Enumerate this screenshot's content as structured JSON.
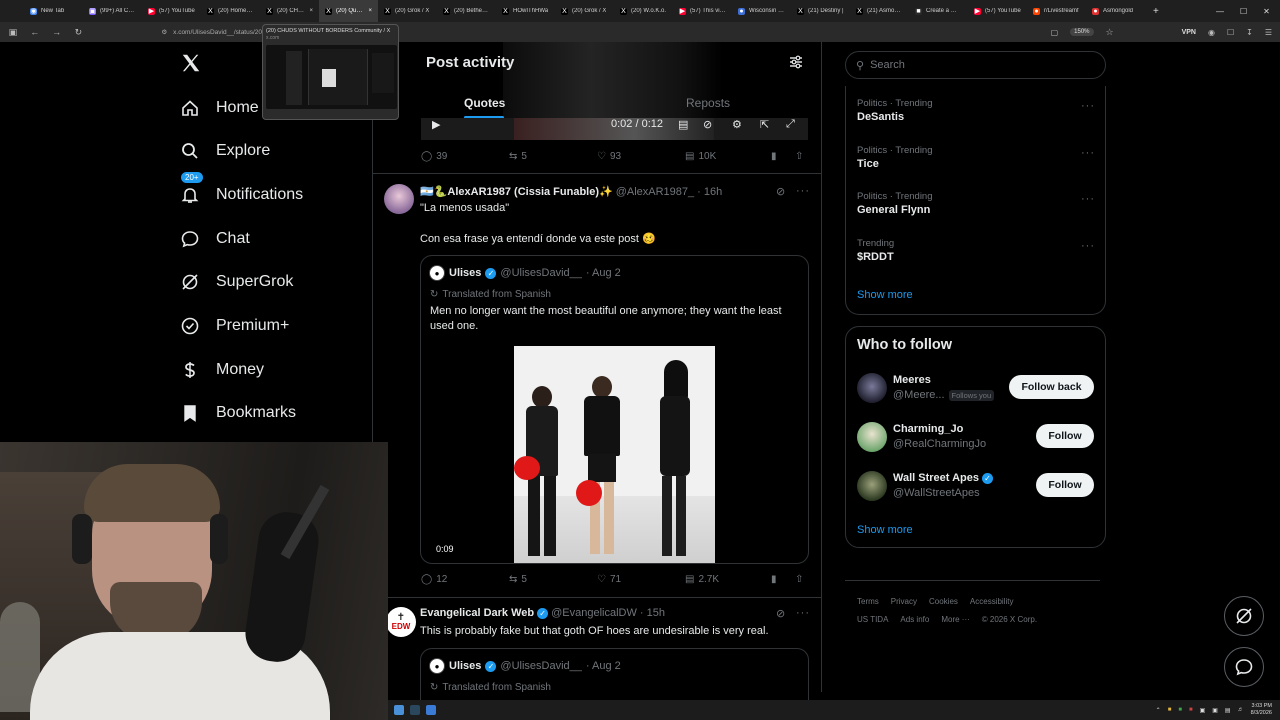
{
  "browser": {
    "tabs": [
      {
        "label": "New Tab",
        "color": "#4285f4",
        "glyph": "◉"
      },
      {
        "label": "(99+) All Cate",
        "color": "#7b5cff",
        "glyph": "▣"
      },
      {
        "label": "(57) YouTube",
        "color": "#ff0033",
        "glyph": "▶"
      },
      {
        "label": "(20) Home / X",
        "color": "#000000",
        "glyph": "X"
      },
      {
        "label": "(20) CHUDS W",
        "color": "#000000",
        "glyph": "X"
      },
      {
        "label": "(20) Quote",
        "color": "#000000",
        "glyph": "X"
      },
      {
        "label": "(20) Grok / X",
        "color": "#000000",
        "glyph": "X"
      },
      {
        "label": "(20) Bethesda",
        "color": "#000000",
        "glyph": "X"
      },
      {
        "label": "HOwIThHWa",
        "color": "#000000",
        "glyph": "X"
      },
      {
        "label": "(20) Grok / X",
        "color": "#000000",
        "glyph": "X"
      },
      {
        "label": "(20) W.o.K.o.",
        "color": "#000000",
        "glyph": "X"
      },
      {
        "label": "(57) This video",
        "color": "#ff0033",
        "glyph": "▶"
      },
      {
        "label": "Wisconsin Go",
        "color": "#3d6fd8",
        "glyph": "●"
      },
      {
        "label": "(21) Destiny |",
        "color": "#000000",
        "glyph": "X"
      },
      {
        "label": "(21) Asmongo",
        "color": "#000000",
        "glyph": "X"
      },
      {
        "label": "Create a Wow",
        "color": "#2a2a2a",
        "glyph": "■"
      },
      {
        "label": "(57) YouTube",
        "color": "#ff0033",
        "glyph": "▶"
      },
      {
        "label": "r/Livestreamf",
        "color": "#ff4500",
        "glyph": "●"
      },
      {
        "label": "Asmongold",
        "color": "#e03030",
        "glyph": "●"
      }
    ],
    "active_tab_index": 5,
    "new_tab": "+",
    "url": "x.com/UlisesDavid__/status/20",
    "zoom": "150%",
    "vpn_label": "VPN",
    "preview": {
      "title": "(20) CHUDS WITHOUT BORDERS Community / X",
      "domain": "x.com"
    }
  },
  "nav": {
    "items": [
      {
        "key": "home",
        "label": "Home",
        "icon": "home-icon"
      },
      {
        "key": "explore",
        "label": "Explore",
        "icon": "search-icon"
      },
      {
        "key": "notifications",
        "label": "Notifications",
        "icon": "bell-icon",
        "badge": "20+"
      },
      {
        "key": "chat",
        "label": "Chat",
        "icon": "chat-icon"
      },
      {
        "key": "supergrok",
        "label": "SuperGrok",
        "icon": "grok-icon"
      },
      {
        "key": "premium",
        "label": "Premium+",
        "icon": "verified-icon"
      },
      {
        "key": "money",
        "label": "Money",
        "icon": "money-icon"
      },
      {
        "key": "bookmarks",
        "label": "Bookmarks",
        "icon": "bookmark-icon"
      }
    ]
  },
  "center": {
    "title": "Post activity",
    "tabs": [
      "Quotes",
      "Reposts"
    ],
    "active_tab": "Quotes",
    "top_video": {
      "time": "0:02 / 0:12"
    },
    "posts": [
      {
        "stats": {
          "replies": "39",
          "reposts": "5",
          "likes": "93",
          "views": "10K"
        }
      },
      {
        "name": "🇦🇷🐍AlexAR1987 (Cissia Funable)✨",
        "handle": "@AlexAR1987_",
        "time": "· 16h",
        "text1": "\"La menos usada\"",
        "text2": "Con esa frase ya entendí donde va este post 🥴",
        "quote": {
          "name": "Ulises",
          "handle": "@UlisesDavid__",
          "time": "· Aug 2",
          "translated": "Translated from Spanish",
          "body": "Men no longer want the most beautiful one anymore; they want the least used one.",
          "video_duration": "0:09"
        },
        "stats": {
          "replies": "12",
          "reposts": "5",
          "likes": "71",
          "views": "2.7K"
        }
      },
      {
        "name": "Evangelical Dark Web",
        "handle": "@EvangelicalDW",
        "time": "· 15h",
        "avatar_text": "EDW",
        "text1": "This is probably fake but that goth OF hoes are undesirable is very real.",
        "quote": {
          "name": "Ulises",
          "handle": "@UlisesDavid__",
          "time": "· Aug 2",
          "translated": "Translated from Spanish"
        }
      }
    ]
  },
  "right": {
    "search_placeholder": "Search",
    "trends": [
      {
        "category": "Politics · Trending",
        "name": "DeSantis"
      },
      {
        "category": "Politics · Trending",
        "name": "Tice"
      },
      {
        "category": "Politics · Trending",
        "name": "General Flynn"
      },
      {
        "category": "Trending",
        "name": "$RDDT"
      }
    ],
    "show_more": "Show more",
    "who_to_follow": {
      "title": "Who to follow",
      "accounts": [
        {
          "name": "Meeres",
          "handle": "@Meere...",
          "follows_you": "Follows you",
          "button": "Follow back",
          "verified": false
        },
        {
          "name": "Charming_Jo",
          "handle": "@RealCharmingJo",
          "button": "Follow",
          "verified": false
        },
        {
          "name": "Wall Street Apes",
          "handle": "@WallStreetApes",
          "button": "Follow",
          "verified": true
        }
      ],
      "show_more": "Show more"
    },
    "footer": {
      "row1": [
        "Terms",
        "Privacy",
        "Cookies",
        "Accessibility"
      ],
      "row2": [
        "US TIDA",
        "Ads info",
        "More ···",
        "© 2026 X Corp."
      ]
    }
  },
  "taskbar": {
    "time": "3:03 PM",
    "date": "8/3/2026"
  },
  "colors": {
    "accent": "#1d9bf0",
    "text": "#e7e9ea",
    "muted": "#71767b",
    "border": "#2f3336"
  }
}
